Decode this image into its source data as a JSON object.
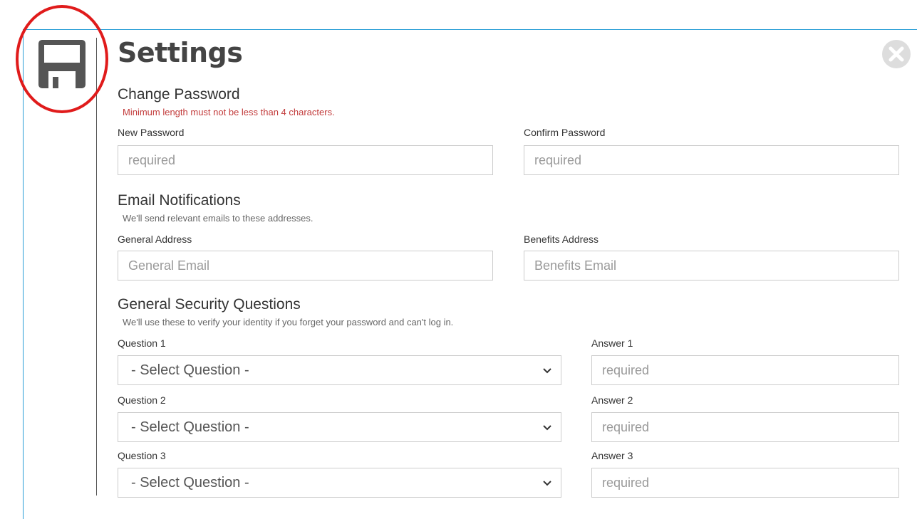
{
  "header": {
    "title": "Settings"
  },
  "icons": {
    "save": "floppy-disk-icon",
    "close": "close-circle-icon",
    "select_chevron": "chevron-down-icon"
  },
  "colors": {
    "modal_border": "#2a9fd6",
    "error_text": "#c23b3b",
    "annotation_circle": "#e01b1b"
  },
  "change_password": {
    "title": "Change Password",
    "error": "Minimum length must not be less than 4 characters.",
    "new_label": "New Password",
    "new_placeholder": "required",
    "confirm_label": "Confirm Password",
    "confirm_placeholder": "required"
  },
  "email_notifications": {
    "title": "Email Notifications",
    "subtitle": "We'll send relevant emails to these addresses.",
    "general_label": "General Address",
    "general_placeholder": "General Email",
    "benefits_label": "Benefits Address",
    "benefits_placeholder": "Benefits Email"
  },
  "security": {
    "title": "General Security Questions",
    "subtitle": "We'll use these to verify your identity if you forget your password and can't log in.",
    "questions": [
      {
        "label": "Question 1",
        "selected": "- Select Question -",
        "answer_label": "Answer 1",
        "answer_placeholder": "required"
      },
      {
        "label": "Question 2",
        "selected": "- Select Question -",
        "answer_label": "Answer 2",
        "answer_placeholder": "required"
      },
      {
        "label": "Question 3",
        "selected": "- Select Question -",
        "answer_label": "Answer 3",
        "answer_placeholder": "required"
      }
    ]
  }
}
